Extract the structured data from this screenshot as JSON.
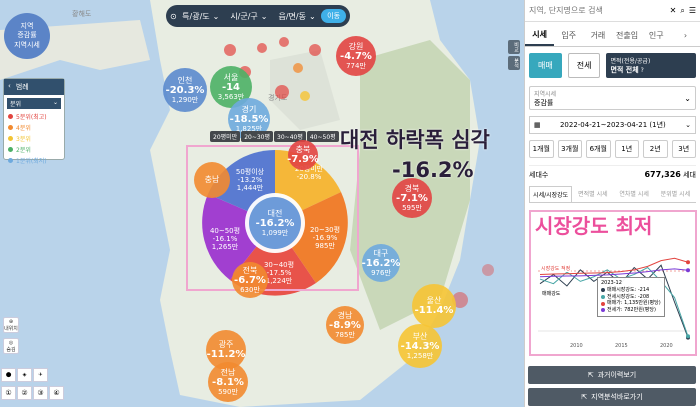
{
  "map": {
    "top_left_circle": {
      "line1": "지역",
      "line2": "증감률",
      "line3": "지역시세"
    },
    "topbar": {
      "selectors": [
        "특/광/도",
        "시/군/구",
        "읍/면/동"
      ],
      "go_label": "이동"
    },
    "legend": {
      "title": "범례",
      "sub": "분위",
      "items": [
        {
          "label": "5분위(최고)",
          "color": "#e2443f"
        },
        {
          "label": "4분위",
          "color": "#f28a30"
        },
        {
          "label": "3분위",
          "color": "#f2c434"
        },
        {
          "label": "2분위",
          "color": "#4cb066"
        },
        {
          "label": "1분위(최저)",
          "color": "#6eaade"
        }
      ]
    },
    "size_bar": [
      "20평미만",
      "20~30평",
      "30~40평",
      "40~50평"
    ],
    "bg_labels": {
      "sea": "황해도",
      "region": "경기도"
    },
    "regions": [
      {
        "name": "인천",
        "pct": "-20.3%",
        "price": "1,290만",
        "color": "blue"
      },
      {
        "name": "서울",
        "pct": "-14",
        "price": "3,563만",
        "color": "green"
      },
      {
        "name": "경기",
        "pct": "-18.5%",
        "price": "1,825만",
        "color": "lblue"
      },
      {
        "name": "강원",
        "pct": "-4.7%",
        "price": "774만",
        "color": "red"
      },
      {
        "name": "충북",
        "pct": "-7.9%",
        "price": "",
        "color": "red"
      },
      {
        "name": "충남",
        "pct": "",
        "price": "",
        "color": "orange"
      },
      {
        "name": "경북",
        "pct": "-7.1%",
        "price": "595만",
        "color": "red"
      },
      {
        "name": "대구",
        "pct": "-16.2%",
        "price": "976만",
        "color": "lblue"
      },
      {
        "name": "울산",
        "pct": "-11.4%",
        "price": "",
        "color": "yellow"
      },
      {
        "name": "경남",
        "pct": "-8.9%",
        "price": "785만",
        "color": "orange"
      },
      {
        "name": "부산",
        "pct": "-14.3%",
        "price": "1,258만",
        "color": "yellow"
      },
      {
        "name": "광주",
        "pct": "-11.2%",
        "price": "",
        "color": "orange"
      },
      {
        "name": "전남",
        "pct": "-8.1%",
        "price": "590만",
        "color": "orange"
      },
      {
        "name": "전북",
        "pct": "-6.7%",
        "price": "630만",
        "color": "orange"
      }
    ],
    "donut": {
      "center": {
        "name": "대전",
        "pct": "-16.2%",
        "price": "1,099만"
      },
      "segments": [
        {
          "label": "50평이상",
          "pct": "-13.2%",
          "price": "1,444만"
        },
        {
          "label": "20평미만",
          "pct": "-20.8%",
          "price": ""
        },
        {
          "label": "20~30평",
          "pct": "-16.9%",
          "price": "985만"
        },
        {
          "label": "30~40평",
          "pct": "-17.5%",
          "price": "1,224만"
        },
        {
          "label": "40~50평",
          "pct": "-16.1%",
          "price": "1,265만"
        }
      ]
    },
    "overlay_headline": "대전 하락폭 심각",
    "overlay_value": "-16.2%",
    "tools": [
      "내위치",
      "숨김",
      "지도"
    ]
  },
  "panel": {
    "search_placeholder": "지역, 단지명으로 검색",
    "tabs": [
      "시세",
      "입주",
      "거래",
      "전출입",
      "인구"
    ],
    "trade": {
      "sale": "매매",
      "jeonse": "전세",
      "area_label": "면적(전용/공급)",
      "area_value": "면적 전체"
    },
    "metric_label": "지역시세",
    "metric_value": "증감률",
    "date_range": "2022-04-21~2023-04-21 (1년)",
    "periods": [
      "1개월",
      "3개월",
      "6개월",
      "1년",
      "2년",
      "3년"
    ],
    "households_label": "세대수",
    "households_value": "677,326",
    "households_unit": "세대",
    "chart_tabs": [
      "시세/시장강도",
      "면적별 시세",
      "연차별 시세",
      "분위별 시세"
    ],
    "chart_overlay": "시장강도 최저",
    "tooltip": {
      "date": "2023-12",
      "rows": [
        {
          "label": "매매시장강도: -214",
          "color": "#2d3e50"
        },
        {
          "label": "전세시장강도: -208",
          "color": "#48a6a6"
        },
        {
          "label": "매매가: 1,135만원(평당)",
          "color": "#e2443f"
        },
        {
          "label": "전세가: 782만원(평당)",
          "color": "#7a3bd6"
        }
      ]
    },
    "chart_tags": {
      "market": "시장강도 적정",
      "trade": "매매강도"
    },
    "x_ticks": [
      "2010",
      "2015",
      "2020"
    ],
    "buttons": [
      "과거이력보기",
      "지역분석바로가기"
    ]
  },
  "chart_data": {
    "type": "line",
    "x_ticks": [
      "2010",
      "2015",
      "2020"
    ],
    "series": [
      {
        "name": "매매시장강도",
        "values": [
          20,
          60,
          10,
          80,
          30,
          70,
          20,
          90,
          40,
          100,
          -60,
          -214
        ]
      },
      {
        "name": "전세시장강도",
        "values": [
          40,
          20,
          70,
          30,
          50,
          80,
          40,
          60,
          90,
          30,
          -40,
          -208
        ]
      },
      {
        "name": "매매가",
        "values": [
          60,
          62,
          63,
          65,
          66,
          68,
          72,
          80,
          95,
          120,
          130,
          113
        ]
      },
      {
        "name": "전세가",
        "values": [
          50,
          52,
          53,
          54,
          56,
          58,
          62,
          66,
          72,
          80,
          84,
          78
        ]
      }
    ]
  }
}
